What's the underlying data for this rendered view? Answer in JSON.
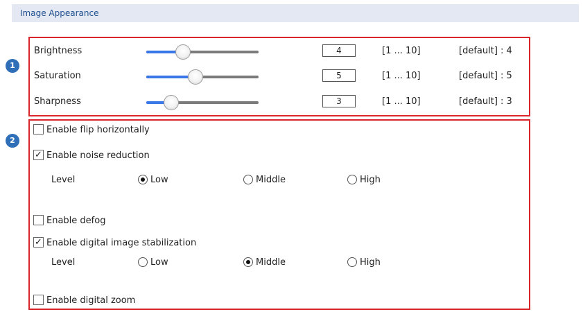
{
  "section": {
    "title": "Image Appearance"
  },
  "badges": [
    "1",
    "2"
  ],
  "sliders": [
    {
      "label": "Brightness",
      "value": "4",
      "range": "[1 ... 10]",
      "default": "[default] : 4",
      "level": 0.33
    },
    {
      "label": "Saturation",
      "value": "5",
      "range": "[1 ... 10]",
      "default": "[default] : 5",
      "level": 0.44
    },
    {
      "label": "Sharpness",
      "value": "3",
      "range": "[1 ... 10]",
      "default": "[default] : 3",
      "level": 0.22
    }
  ],
  "options": {
    "flip": {
      "label": "Enable flip horizontally",
      "checked": false
    },
    "noise": {
      "label": "Enable noise reduction",
      "checked": true
    },
    "noise_level": {
      "label": "Level",
      "low": "Low",
      "middle": "Middle",
      "high": "High",
      "selected": "Low"
    },
    "defog": {
      "label": "Enable defog",
      "checked": false
    },
    "dis": {
      "label": "Enable digital image stabilization",
      "checked": true
    },
    "dis_level": {
      "label": "Level",
      "low": "Low",
      "middle": "Middle",
      "high": "High",
      "selected": "Middle"
    },
    "zoom": {
      "label": "Enable digital zoom",
      "checked": false
    }
  },
  "check_glyph": "✓",
  "colors": {
    "accent": "#3b78e7",
    "panel_border": "#d9252c",
    "badge": "#2e6fb7",
    "header_bg": "#e3e8f2"
  }
}
